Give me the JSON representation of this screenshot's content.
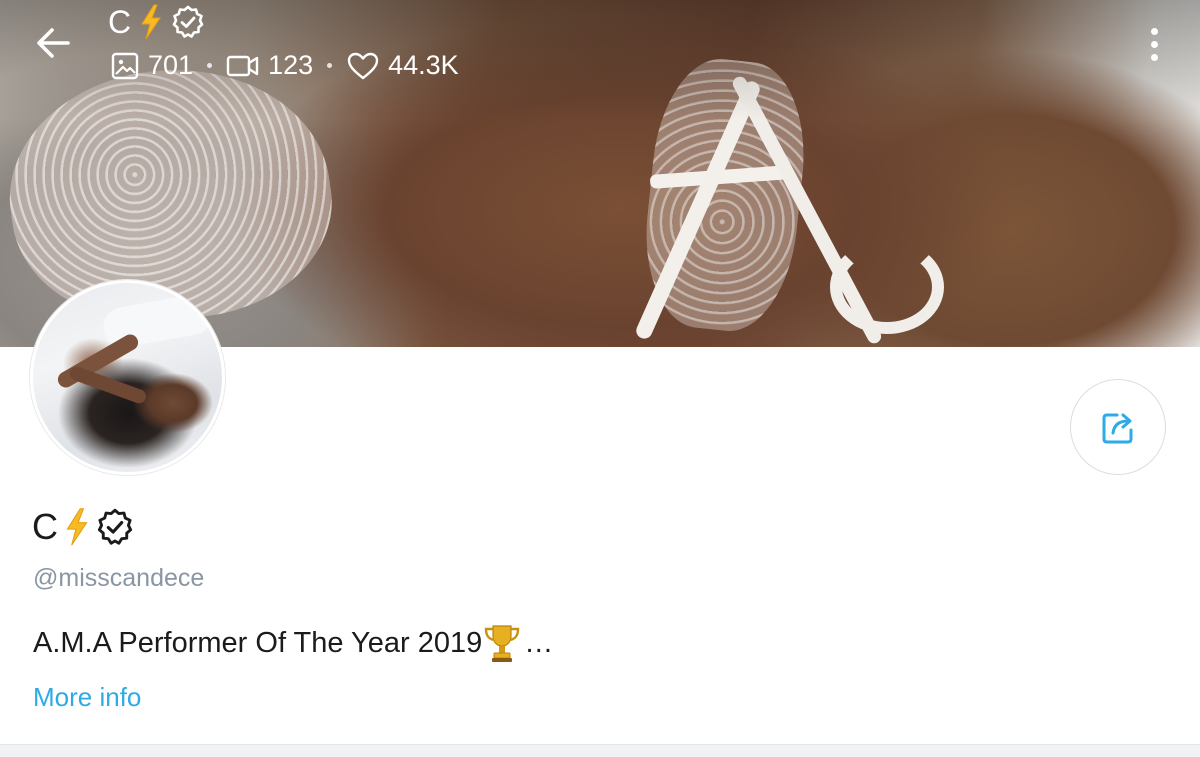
{
  "header": {
    "name": "C",
    "stats": {
      "photos": "701",
      "videos": "123",
      "likes": "44.3K"
    }
  },
  "profile": {
    "name": "C",
    "handle": "@misscandece",
    "bio": "A.M.A Performer Of The Year 2019",
    "bio_ellipsis": "…",
    "more_info_label": "More info"
  },
  "icons": {
    "back": "arrow-left-icon",
    "lightning": "lightning-emoji",
    "verified": "verified-badge-icon",
    "photo": "image-icon",
    "video": "video-camera-icon",
    "like": "heart-icon",
    "more": "vertical-dots-icon",
    "share": "share-icon",
    "trophy": "trophy-emoji"
  },
  "colors": {
    "accent": "#2eaae7",
    "handle": "#8a96a3",
    "lightning": "#f7b924",
    "trophy": "#d9a21b"
  }
}
